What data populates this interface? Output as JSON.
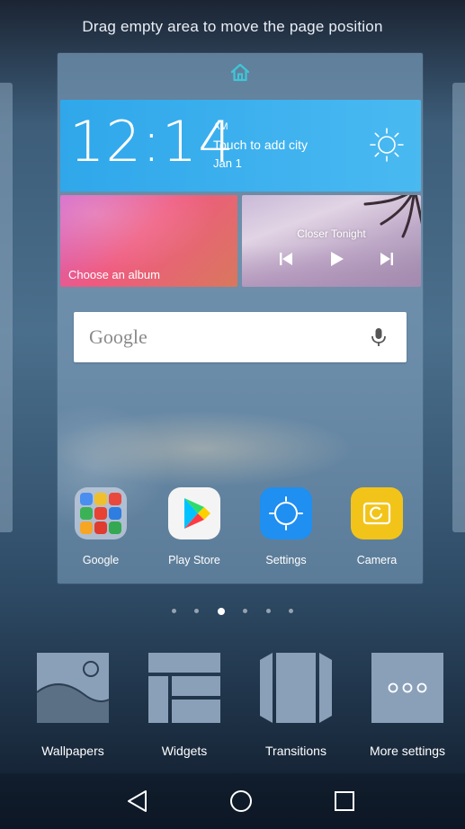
{
  "hint": "Drag empty area to move the page position",
  "clock": {
    "time": "12:14",
    "ampm": "AM",
    "city_prompt": "Touch to add city",
    "date": "Jan 1",
    "weather_icon": "sun-icon"
  },
  "album": {
    "label": "Choose an album"
  },
  "music": {
    "song": "Closer Tonight"
  },
  "search": {
    "brand": "Google",
    "icon": "mic-icon"
  },
  "apps": [
    {
      "label": "Google"
    },
    {
      "label": "Play Store"
    },
    {
      "label": "Settings"
    },
    {
      "label": "Camera"
    }
  ],
  "pager": {
    "count": 6,
    "active_index": 2
  },
  "options": [
    {
      "label": "Wallpapers"
    },
    {
      "label": "Widgets"
    },
    {
      "label": "Transitions"
    },
    {
      "label": "More settings"
    }
  ],
  "nav": [
    "back",
    "home",
    "recents"
  ],
  "colors": {
    "clock_widget": "#2fa7ea",
    "accent_home": "#3fc6d8",
    "settings_blue": "#1f8ff1",
    "camera_yellow": "#f2c419"
  }
}
